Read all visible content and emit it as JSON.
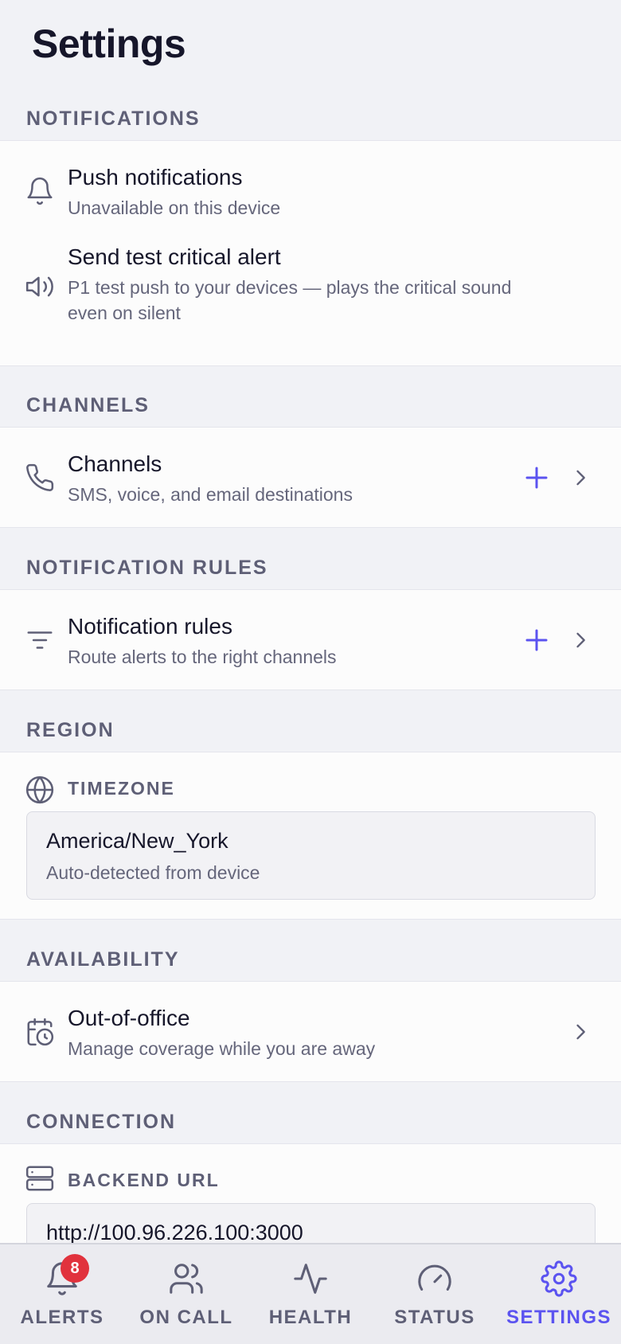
{
  "header": {
    "title": "Settings"
  },
  "notifications": {
    "section_label": "NOTIFICATIONS",
    "push": {
      "title": "Push notifications",
      "subtitle": "Unavailable on this device",
      "icon": "bell-icon"
    },
    "test_alert": {
      "title": "Send test critical alert",
      "subtitle_line1": "P1 test push to your devices — plays the critical sound",
      "subtitle_line2": "even on silent",
      "icon": "speaker-icon"
    }
  },
  "channels": {
    "section_label": "CHANNELS",
    "row": {
      "title": "Channels",
      "subtitle": "SMS, voice, and email destinations",
      "icon": "phone-icon"
    }
  },
  "notification_rules": {
    "section_label": "NOTIFICATION RULES",
    "row": {
      "title": "Notification rules",
      "subtitle": "Route alerts to the right channels",
      "icon": "filter-icon"
    }
  },
  "region": {
    "section_label": "REGION",
    "timezone": {
      "label": "TIMEZONE",
      "value": "America/New_York",
      "help": "Auto-detected from device",
      "icon": "globe-icon"
    }
  },
  "availability": {
    "section_label": "AVAILABILITY",
    "ooo": {
      "title": "Out-of-office",
      "subtitle": "Manage coverage while you are away",
      "icon": "calendar-clock-icon"
    }
  },
  "connection": {
    "section_label": "CONNECTION",
    "backend": {
      "label": "BACKEND URL",
      "value": "http://100.96.226.100:3000",
      "icon": "server-icon"
    }
  },
  "tabs": [
    {
      "label": "ALERTS",
      "icon": "bell-icon",
      "badge": "8",
      "active": false
    },
    {
      "label": "ON CALL",
      "icon": "users-icon",
      "active": false
    },
    {
      "label": "HEALTH",
      "icon": "activity-icon",
      "active": false
    },
    {
      "label": "STATUS",
      "icon": "gauge-icon",
      "active": false
    },
    {
      "label": "SETTINGS",
      "icon": "gear-icon",
      "active": true
    }
  ],
  "colors": {
    "accent": "#5b53f0",
    "background": "#f1f2f6",
    "card": "#fcfcfc",
    "badge": "#e1323d",
    "muted_text": "#5e5f76"
  }
}
